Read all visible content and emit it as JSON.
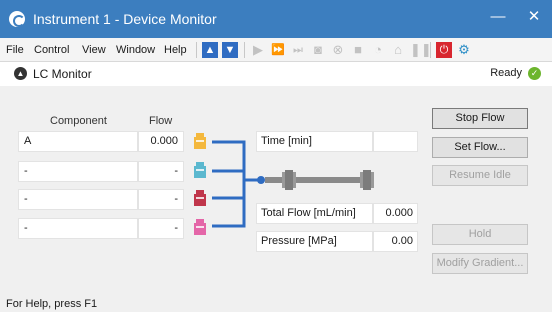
{
  "window": {
    "title": "Instrument 1 - Device Monitor",
    "minimize_glyph": "—",
    "close_glyph": "✕"
  },
  "menu": {
    "items": [
      "File",
      "Control",
      "View",
      "Window",
      "Help"
    ]
  },
  "panel": {
    "title": "LC Monitor",
    "status": "Ready"
  },
  "table": {
    "headers": {
      "component": "Component",
      "flow": "Flow"
    },
    "rows": [
      {
        "component": "A",
        "flow": "0.000",
        "bottle_color": "#f4b83d"
      },
      {
        "component": "-",
        "flow": "-",
        "bottle_color": "#5bb8cf"
      },
      {
        "component": "-",
        "flow": "-",
        "bottle_color": "#c0364b"
      },
      {
        "component": "-",
        "flow": "-",
        "bottle_color": "#e466a8"
      }
    ]
  },
  "readouts": {
    "time_label": "Time [min]",
    "time_value": "",
    "total_flow_label": "Total Flow [mL/min]",
    "total_flow_value": "0.000",
    "pressure_label": "Pressure [MPa]",
    "pressure_value": "0.00"
  },
  "buttons": {
    "stop_flow": "Stop Flow",
    "set_flow": "Set Flow...",
    "resume_idle": "Resume Idle",
    "hold": "Hold",
    "modify_gradient": "Modify Gradient..."
  },
  "statusbar": {
    "text": "For Help, press F1"
  },
  "colors": {
    "titlebar": "#3c7ebf",
    "flow_line": "#2f6cc2",
    "ready_ok": "#6cb52d",
    "column": "#8a8a8a"
  }
}
